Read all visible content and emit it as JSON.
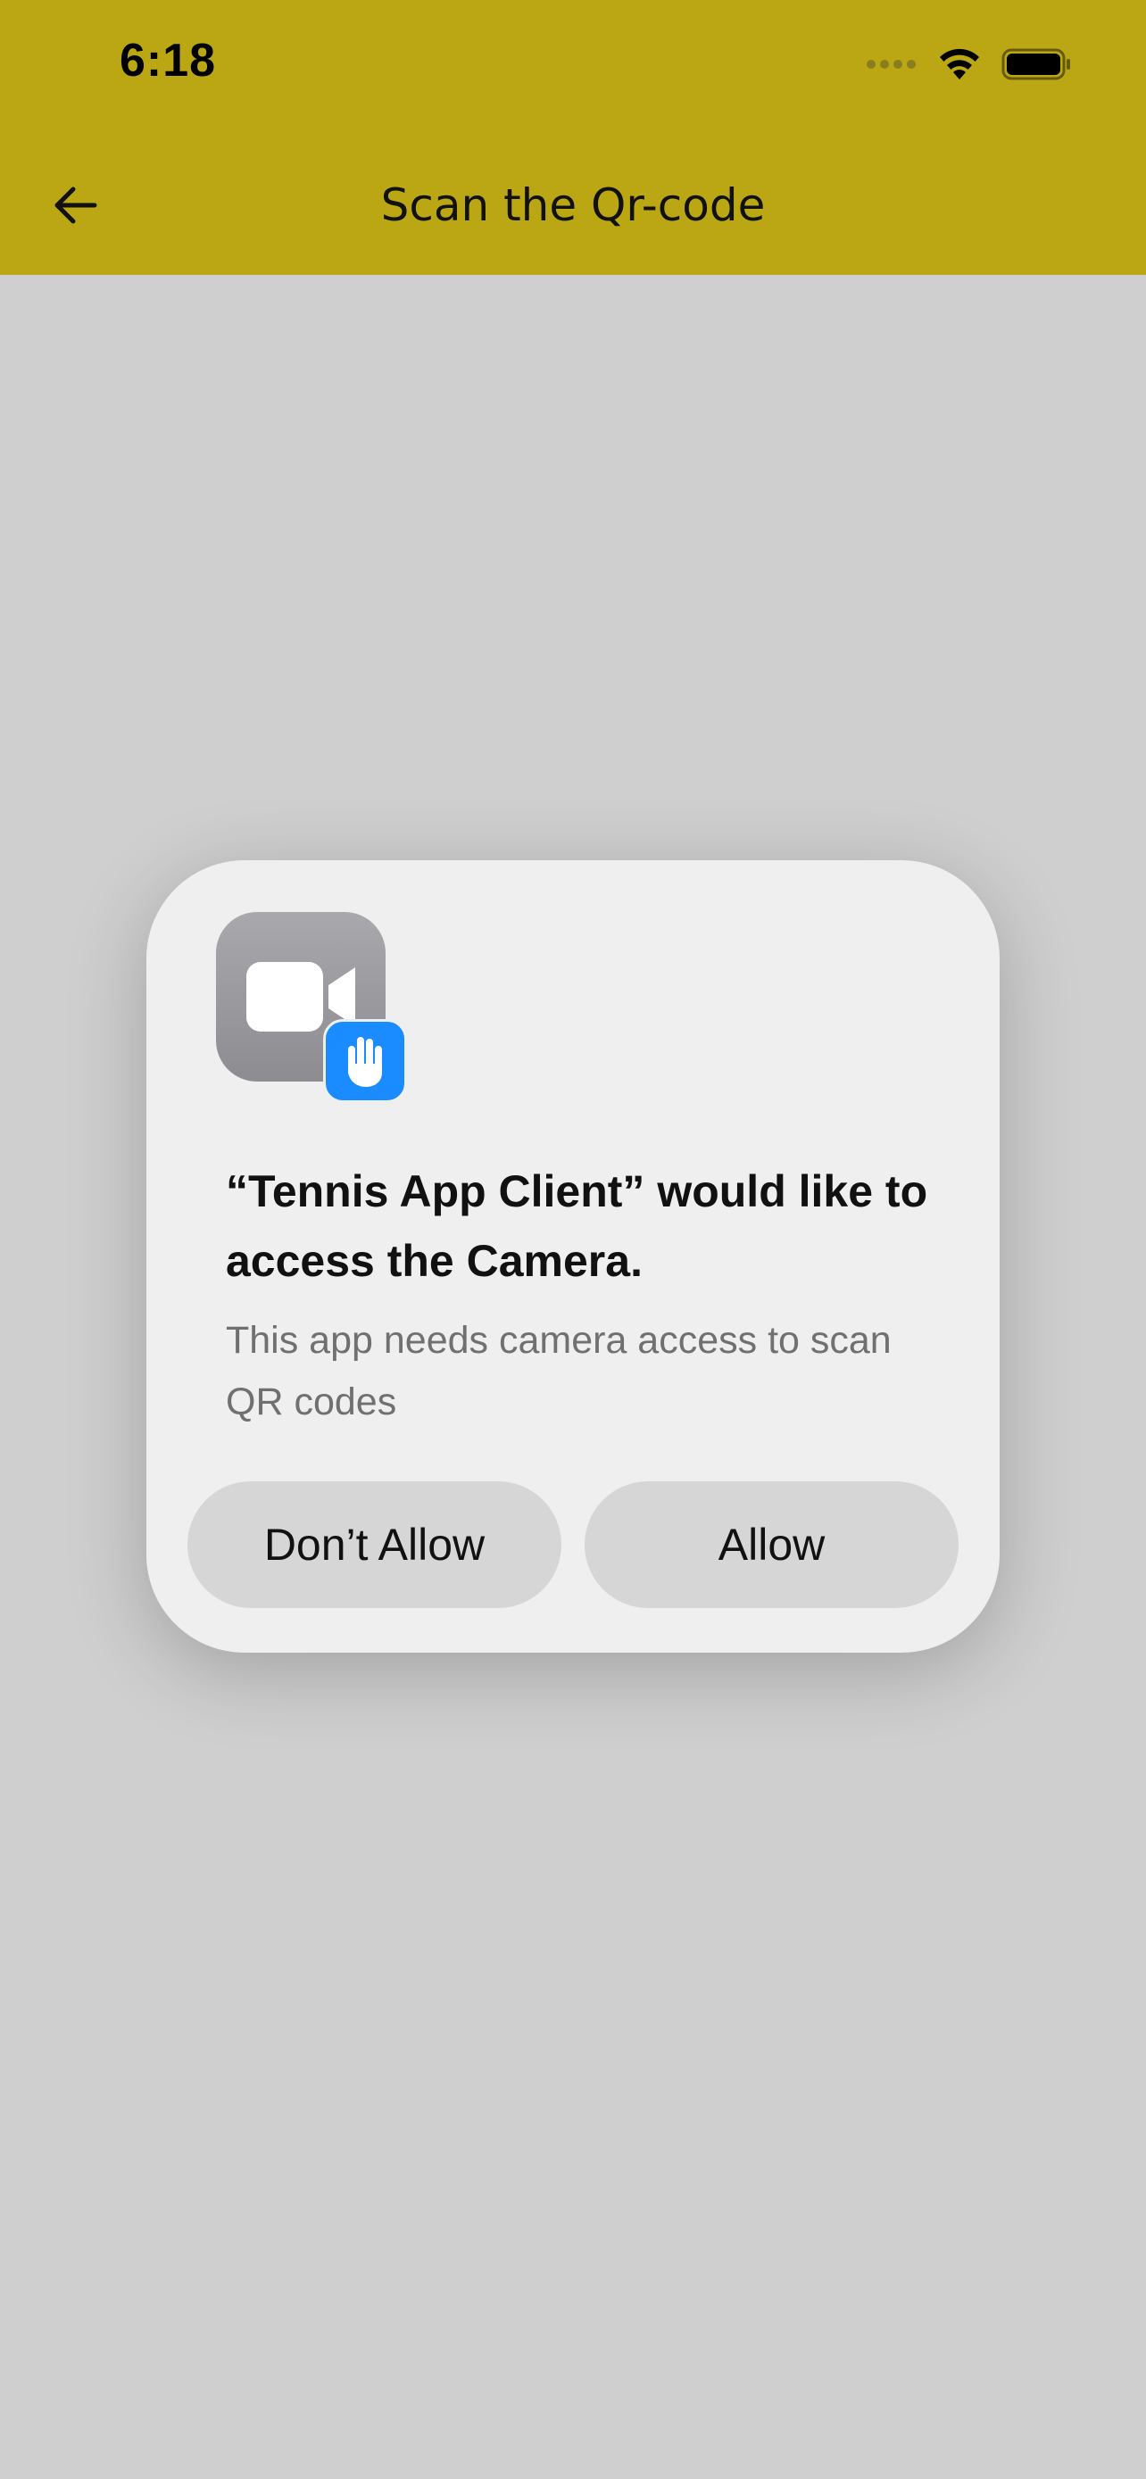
{
  "status_bar": {
    "time": "6:18",
    "icons": [
      "signal-icon",
      "wifi-icon",
      "battery-icon"
    ]
  },
  "app_bar": {
    "title": "Scan the Qr-code",
    "back_icon": "arrow-left-icon",
    "background_color": "#bba714"
  },
  "permission_dialog": {
    "icon": "camera-permission-icon",
    "badge_icon": "hand-stop-icon",
    "title": "“Tennis App Client” would like to access the Camera.",
    "message": "This app needs camera access to scan QR codes",
    "buttons": {
      "deny": "Don’t Allow",
      "allow": "Allow"
    }
  },
  "colors": {
    "accent": "#bba714",
    "backdrop": "#cfcfcf",
    "dialog_background": "#efefef",
    "button_background": "#d6d6d6",
    "badge_blue": "#1a8cff"
  }
}
